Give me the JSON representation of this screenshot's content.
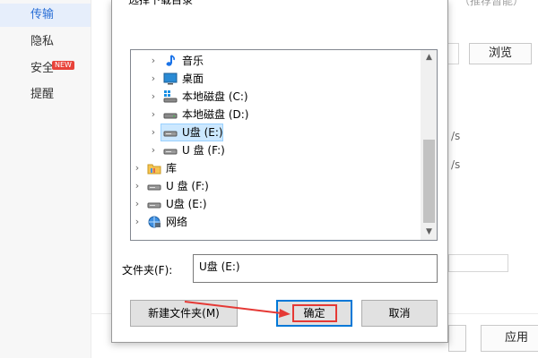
{
  "sidebar": {
    "items": [
      {
        "label": "传输",
        "active": true
      },
      {
        "label": "隐私",
        "active": false
      },
      {
        "label": "安全",
        "active": false,
        "badge": "NEW"
      },
      {
        "label": "提醒",
        "active": false
      }
    ]
  },
  "background": {
    "hint_text": "（推荐暂能）",
    "browse_label": "浏览",
    "rate_unit_1": "/s",
    "rate_unit_2": "/s",
    "apply_label": "应用"
  },
  "dialog": {
    "title": "选择下载目录",
    "tree_items": [
      {
        "label": "音乐",
        "icon": "music-note-icon",
        "chevron": "›",
        "level": 1,
        "selected": false
      },
      {
        "label": "桌面",
        "icon": "desktop-icon",
        "chevron": "›",
        "level": 1,
        "selected": false
      },
      {
        "label": "本地磁盘 (C:)",
        "icon": "windows-drive-icon",
        "chevron": "›",
        "level": 1,
        "selected": false
      },
      {
        "label": "本地磁盘 (D:)",
        "icon": "hard-drive-icon",
        "chevron": "›",
        "level": 1,
        "selected": false
      },
      {
        "label": "U盘 (E:)",
        "icon": "usb-drive-icon",
        "chevron": "›",
        "level": 1,
        "selected": true
      },
      {
        "label": "U 盘 (F:)",
        "icon": "usb-drive-icon",
        "chevron": "›",
        "level": 1,
        "selected": false
      },
      {
        "label": "库",
        "icon": "library-folder-icon",
        "chevron": "›",
        "level": 0,
        "selected": false
      },
      {
        "label": "U 盘 (F:)",
        "icon": "usb-drive-icon",
        "chevron": "›",
        "level": 0,
        "selected": false
      },
      {
        "label": "U盘 (E:)",
        "icon": "usb-drive-icon",
        "chevron": "›",
        "level": 0,
        "selected": false
      },
      {
        "label": "网络",
        "icon": "network-icon",
        "chevron": "›",
        "level": 0,
        "selected": false
      }
    ],
    "scroll_up": "▲",
    "scroll_down": "▼",
    "folder_label": "文件夹(F):",
    "folder_value": "U盘 (E:)",
    "new_folder_label": "新建文件夹(M)",
    "ok_label": "确定",
    "cancel_label": "取消"
  },
  "colors": {
    "accent": "#2a6fd6",
    "selection": "#cce8ff",
    "annotation_red": "#e53935",
    "focus_blue": "#0078d7"
  }
}
